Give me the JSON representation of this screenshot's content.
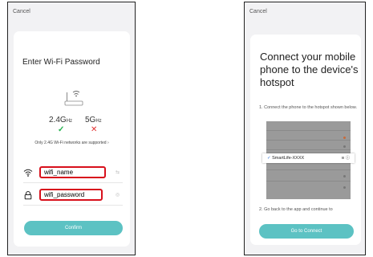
{
  "left_screen": {
    "cancel_label": "Cancel",
    "title": "Enter Wi-Fi Password",
    "bands": {
      "band_24": "2.4G",
      "band_24_unit": "Hz",
      "band_5": "5G",
      "band_5_unit": "Hz",
      "ok_mark": "✓",
      "no_mark": "✕"
    },
    "note": "Only 2.4G Wi-Fi networks are supported ›",
    "wifi_field": {
      "value": "wifi_name"
    },
    "password_field": {
      "value": "wifi_password"
    },
    "confirm_label": "Confirm"
  },
  "right_screen": {
    "cancel_label": "Cancel",
    "title": "Connect your mobile phone to the device's hotspot",
    "step_1": "1. Connect the phone to the hotspot shown below.",
    "hotspot_name": "SmartLife-XXXX",
    "step_2": "2. Go back to the app and continue to",
    "goto_label": "Go to Connect"
  },
  "colors": {
    "accent": "#5cc2c3",
    "ok": "#22b14c",
    "error": "#e23030",
    "highlight_border": "#d8101c"
  },
  "icons": [
    "router-icon",
    "wifi-icon",
    "lock-icon",
    "switch-icon",
    "eye-icon",
    "check-icon",
    "wifi-signal-icon",
    "info-icon"
  ]
}
